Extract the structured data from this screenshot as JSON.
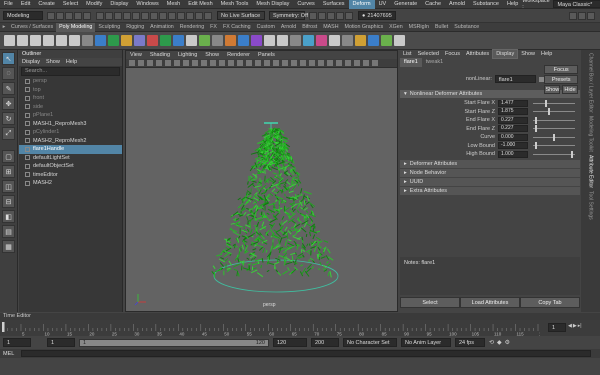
{
  "menubar": [
    "File",
    "Edit",
    "Create",
    "Select",
    "Modify",
    "Display",
    "Windows",
    "Mesh",
    "Edit Mesh",
    "Mesh Tools",
    "Mesh Display",
    "Curves",
    "Surfaces",
    "Deform",
    "UV",
    "Generate",
    "Cache",
    "Arnold",
    "Substance",
    "Help"
  ],
  "menubar_highlight": "Deform",
  "workspace_label": "Workspace :",
  "workspace_value": "Maya Classic*",
  "status": {
    "mode": "Modeling",
    "live_surface": "No Live Surface",
    "symmetry": "Symmetry: Off",
    "id": "21407695"
  },
  "shelf_tabs": [
    "Curves / Surfaces",
    "Poly Modeling",
    "Sculpting",
    "Rigging",
    "Animation",
    "Rendering",
    "FX",
    "FX Caching",
    "Custom",
    "Arnold",
    "Bifrost",
    "MASH",
    "Motion Graphics",
    "XGen",
    "MSRigIn",
    "Bullet",
    "Substance"
  ],
  "shelf_tab_selected": "Poly Modeling",
  "outliner": {
    "title": "Outliner",
    "menu": [
      "Display",
      "Show",
      "Help"
    ],
    "search_placeholder": "Search...",
    "items": [
      {
        "label": "persp",
        "state": "dim"
      },
      {
        "label": "top",
        "state": "dim"
      },
      {
        "label": "front",
        "state": "dim"
      },
      {
        "label": "side",
        "state": "dim"
      },
      {
        "label": "pPlane1",
        "state": "dim"
      },
      {
        "label": "MASH1_ReproMesh3",
        "state": "normal"
      },
      {
        "label": "pCylinder1",
        "state": "dim"
      },
      {
        "label": "MASH2_ReproMesh2",
        "state": "normal"
      },
      {
        "label": "flare1Handle",
        "state": "sel"
      },
      {
        "label": "defaultLightSet",
        "state": "normal"
      },
      {
        "label": "defaultObjectSet",
        "state": "normal"
      },
      {
        "label": "timeEditor",
        "state": "normal"
      },
      {
        "label": "MASH2",
        "state": "normal"
      }
    ]
  },
  "viewport": {
    "menu": [
      "View",
      "Shading",
      "Lighting",
      "Show",
      "Renderer",
      "Panels"
    ],
    "camera_label": "persp"
  },
  "attribute_editor": {
    "menu": [
      "List",
      "Selected",
      "Focus",
      "Attributes",
      "Display",
      "Show",
      "Help"
    ],
    "menu_selected": "Display",
    "tabs": [
      "flare1",
      "tweak1"
    ],
    "node_label": "nonLinear:",
    "node_value": "flare1",
    "buttons": [
      "Focus",
      "Presets",
      "Show",
      "Hide"
    ],
    "section_open": "Nonlinear Deformer Attributes",
    "attributes": [
      {
        "label": "Start Flare X",
        "value": "1.477",
        "slider": 0.3
      },
      {
        "label": "Start Flare Z",
        "value": "1.875",
        "slider": 0.38
      },
      {
        "label": "End Flare X",
        "value": "0.227",
        "slider": 0.05
      },
      {
        "label": "End Flare Z",
        "value": "0.227",
        "slider": 0.05
      },
      {
        "label": "Curve",
        "value": "0.000",
        "slider": 0.5
      },
      {
        "label": "Low Bound",
        "value": "-1.000",
        "slider": 0.05
      },
      {
        "label": "High Bound",
        "value": "1.000",
        "slider": 0.95
      }
    ],
    "sections_closed": [
      "Deformer Attributes",
      "Node Behavior",
      "UUID",
      "Extra Attributes"
    ],
    "notes_label": "Notes:  flare1",
    "bottom_buttons": [
      "Select",
      "Load Attributes",
      "Copy Tab"
    ]
  },
  "side_tabs": [
    "Channel Box / Layer Editor",
    "Modeling Toolkit",
    "Attribute Editor",
    "Tool Settings"
  ],
  "side_tab_selected": "Attribute Editor",
  "time_editor_label": "Time Editor",
  "timeline": {
    "ticks": [
      "5",
      "10",
      "15",
      "20",
      "25",
      "30",
      "35",
      "40",
      "45",
      "50",
      "55",
      "60",
      "65",
      "70",
      "75",
      "80",
      "85",
      "90",
      "95",
      "100",
      "105",
      "110",
      "115",
      "12"
    ],
    "current": "1"
  },
  "range": {
    "start": "1",
    "start_inner": "1",
    "slider_start": "1",
    "slider_end": "120",
    "end_inner": "120",
    "end": "200",
    "character_set": "No Character Set",
    "anim_layer": "No Anim Layer",
    "fps": "24 fps"
  },
  "mel_label": "MEL",
  "colors": {
    "selection": "#5285a6",
    "tree": "#1fa31f",
    "ground_ring": "#3fbfa0",
    "deformer_handle": "#3fd9b0"
  }
}
